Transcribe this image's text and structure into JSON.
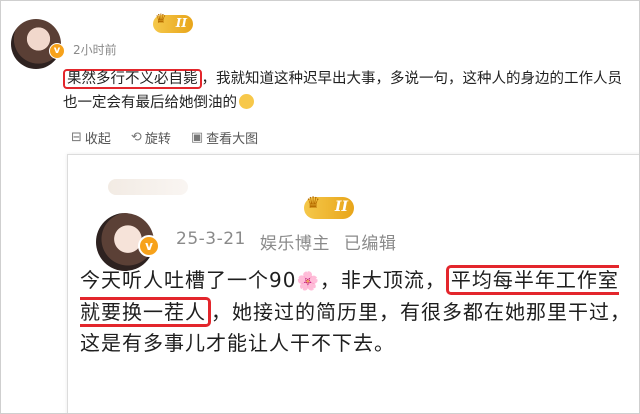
{
  "comment": {
    "time": "2小时前",
    "badge_level": "II",
    "highlight": "果然多行不义必自毙",
    "text_rest": "，我就知道这种迟早出大事，多说一句，这种人的身边的工作人员也一定会有最后给她倒油的",
    "emoji": "sad-face-emoji",
    "actions": {
      "collect": "收起",
      "rotate": "旋转",
      "view_large": "查看大图"
    }
  },
  "screenshot": {
    "badge_level": "II",
    "date": "25-3-21",
    "role": "娱乐博主",
    "edited": "已编辑",
    "text_part1": "今天听人吐槽了一个90",
    "flower": "🌸",
    "text_part2": "，非大顶流，",
    "highlight1": "平均每半年工作室就要换一茬人",
    "text_part3": "，她接过的简历里，有很多都在她那里干过，这是有多事儿才能让人干不下去。"
  },
  "colors": {
    "highlight_border": "#e3262c",
    "badge": "#f5c84a",
    "meta_gray": "#8a8a8a"
  }
}
